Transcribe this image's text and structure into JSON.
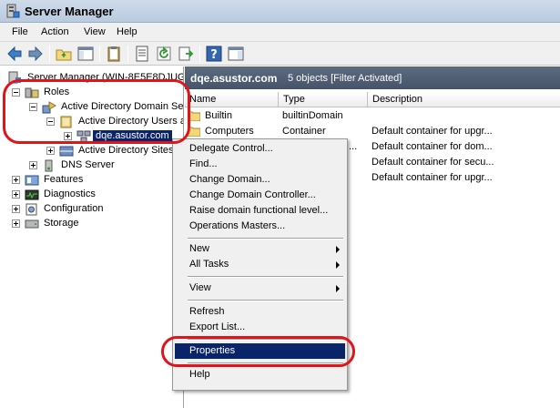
{
  "window": {
    "title": "Server Manager"
  },
  "menu": [
    "File",
    "Action",
    "View",
    "Help"
  ],
  "tree": {
    "root": "Server Manager (WIN-8E5E8DJUGV",
    "roles": "Roles",
    "adds": "Active Directory Domain Se",
    "aduc": "Active Directory Users a",
    "domain": "dqe.asustor.com",
    "sites": "Active Directory Sites",
    "dns": "DNS Server",
    "features": "Features",
    "diagnostics": "Diagnostics",
    "configuration": "Configuration",
    "storage": "Storage"
  },
  "details": {
    "domain": "dqe.asustor.com",
    "count": "5 objects  [Filter Activated]",
    "columns": [
      "Name",
      "Type",
      "Description"
    ],
    "rows": [
      {
        "name": "Builtin",
        "type": "builtinDomain",
        "desc": ""
      },
      {
        "name": "Computers",
        "type": "Container",
        "desc": "Default container for upgr..."
      },
      {
        "name": "",
        "type": "...",
        "desc": "Default container for dom..."
      },
      {
        "name": "",
        "type": "",
        "desc": "Default container for secu..."
      },
      {
        "name": "",
        "type": "",
        "desc": "Default container for upgr..."
      }
    ]
  },
  "context_menu": {
    "delegate": "Delegate Control...",
    "find": "Find...",
    "change_domain": "Change Domain...",
    "change_dc": "Change Domain Controller...",
    "raise": "Raise domain functional level...",
    "ops": "Operations Masters...",
    "new": "New",
    "all_tasks": "All Tasks",
    "view": "View",
    "refresh": "Refresh",
    "export": "Export List...",
    "properties": "Properties",
    "help": "Help"
  },
  "colors": {
    "highlight": "#0a246a",
    "annotation": "#e0141b",
    "header": "#46546a"
  }
}
